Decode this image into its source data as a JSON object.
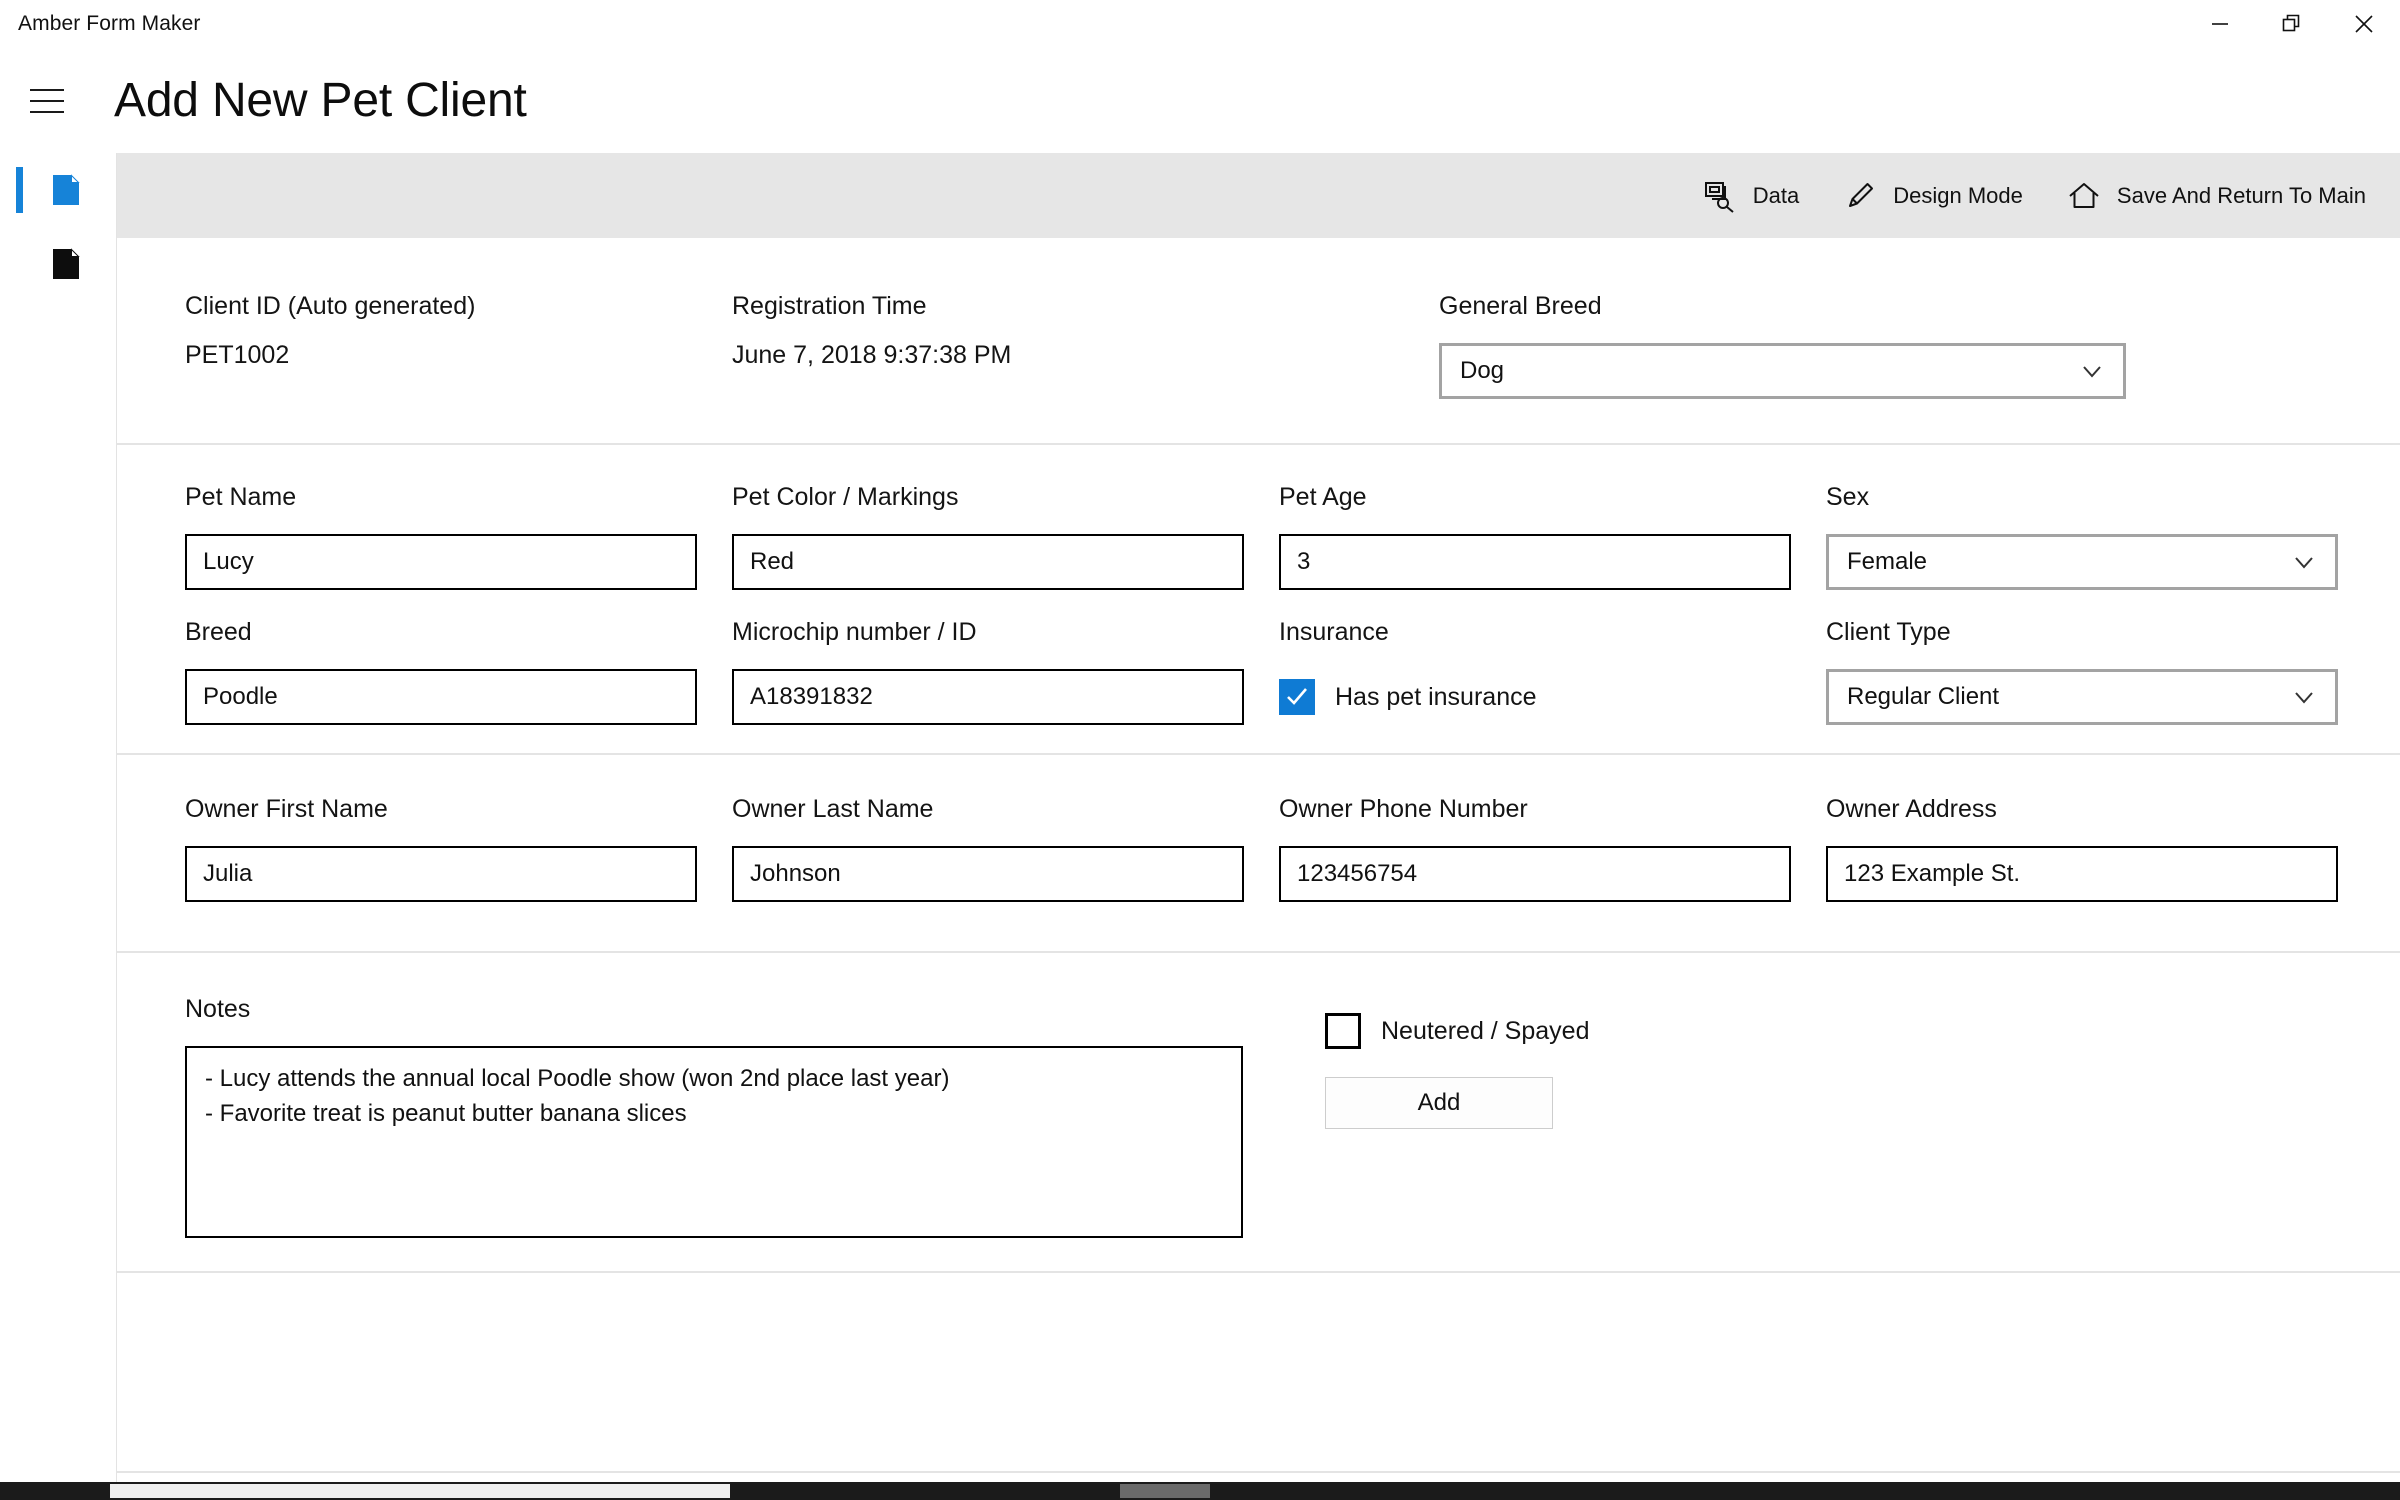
{
  "window": {
    "app_title": "Amber Form Maker",
    "controls": {
      "minimize": "minimize-icon",
      "restore": "restore-icon",
      "close": "close-icon"
    }
  },
  "header": {
    "menu_icon": "hamburger-icon",
    "page_title": "Add New Pet Client"
  },
  "left_rail": {
    "items": [
      {
        "icon": "page-icon",
        "selected": true
      },
      {
        "icon": "page-icon",
        "selected": false
      }
    ]
  },
  "toolbar": {
    "buttons": [
      {
        "label": "Data",
        "icon": "data-search-icon"
      },
      {
        "label": "Design Mode",
        "icon": "pencil-icon"
      },
      {
        "label": "Save And Return To Main",
        "icon": "home-icon"
      }
    ]
  },
  "form": {
    "section_header": {
      "client_id_label": "Client ID (Auto generated)",
      "client_id_value": "PET1002",
      "registration_time_label": "Registration Time",
      "registration_time_value": "June 7, 2018 9:37:38 PM",
      "general_breed_label": "General Breed",
      "general_breed_value": "Dog"
    },
    "section_pet": {
      "pet_name_label": "Pet Name",
      "pet_name_value": "Lucy",
      "pet_color_label": "Pet Color / Markings",
      "pet_color_value": "Red",
      "pet_age_label": "Pet Age",
      "pet_age_value": "3",
      "sex_label": "Sex",
      "sex_value": "Female",
      "breed_label": "Breed",
      "breed_value": "Poodle",
      "microchip_label": "Microchip number / ID",
      "microchip_value": "A18391832",
      "insurance_label": "Insurance",
      "insurance_checkbox_label": "Has pet insurance",
      "insurance_checked": true,
      "client_type_label": "Client Type",
      "client_type_value": "Regular Client"
    },
    "section_owner": {
      "first_name_label": "Owner First Name",
      "first_name_value": "Julia",
      "last_name_label": "Owner Last Name",
      "last_name_value": "Johnson",
      "phone_label": "Owner Phone Number",
      "phone_value": "123456754",
      "address_label": "Owner Address",
      "address_value": "123 Example St."
    },
    "section_notes": {
      "notes_label": "Notes",
      "notes_value": "- Lucy attends the annual local Poodle show (won 2nd place last year)\n- Favorite treat is peanut butter banana slices",
      "neutered_label": "Neutered / Spayed",
      "neutered_checked": false,
      "add_button_label": "Add"
    }
  },
  "colors": {
    "accent": "#1683d8",
    "checkbox_checked": "#0f7bd4",
    "toolbar_bg": "#e6e6e6",
    "divider": "#e4e4e4"
  }
}
